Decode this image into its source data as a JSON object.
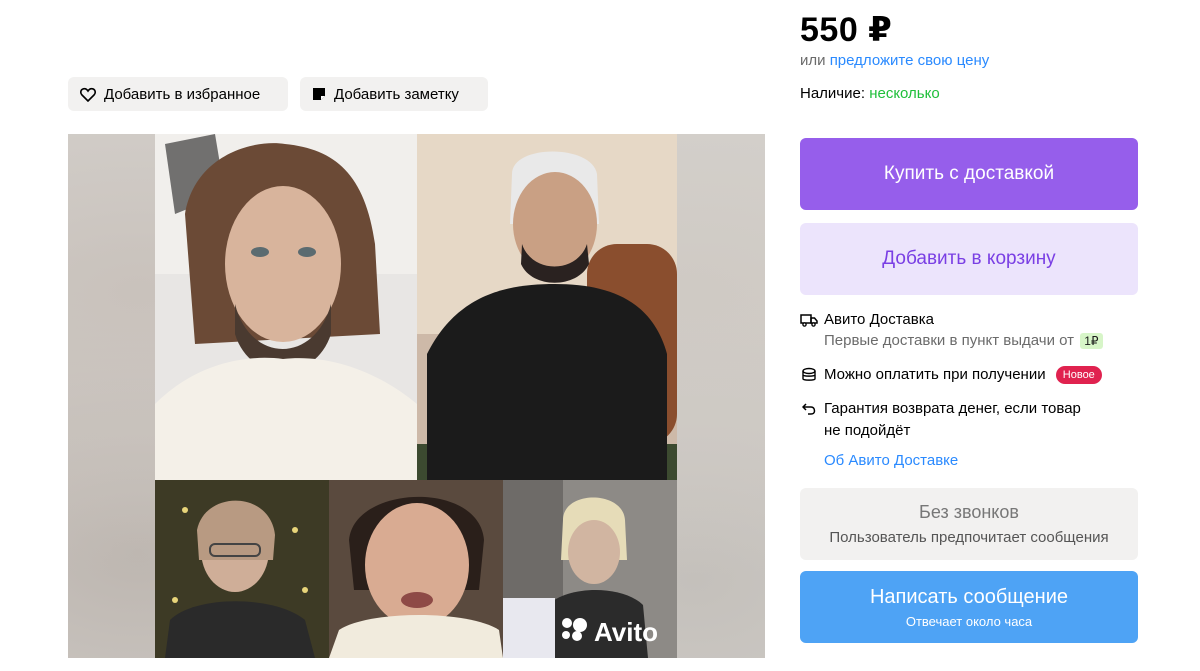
{
  "actions": {
    "favorite_label": "Добавить в избранное",
    "note_label": "Добавить заметку"
  },
  "gallery": {
    "watermark": "Avito"
  },
  "listing": {
    "price": "550 ₽",
    "price_alt_prefix": "или",
    "price_alt_link": "предложите свою цену",
    "stock_label": "Наличие:",
    "stock_value": "несколько"
  },
  "buttons": {
    "buy_label": "Купить с доставкой",
    "cart_label": "Добавить в корзину"
  },
  "delivery": {
    "title": "Авито Доставка",
    "subtitle": "Первые доставки в пункт выдачи от",
    "price_badge": "1₽",
    "pay_on_receipt": "Можно оплатить при получении",
    "new_badge": "Новое",
    "guarantee_line1": "Гарантия возврата денег, если товар",
    "guarantee_line2": "не подойдёт",
    "about_link": "Об Авито Доставке"
  },
  "contact": {
    "no_calls_title": "Без звонков",
    "no_calls_subtitle": "Пользователь предпочитает сообщения",
    "message_label": "Написать сообщение",
    "message_sub": "Отвечает около часа"
  },
  "colors": {
    "buy": "#965eeb",
    "cart_bg": "#ece4fc",
    "message": "#4ea3f5",
    "stock_green": "#1fbf3a",
    "link_blue": "#2a8aff",
    "new_badge": "#e0224f"
  },
  "icons": [
    "heart-icon",
    "note-icon",
    "truck-icon",
    "coins-icon",
    "return-arrow-icon",
    "avito-logo-icon"
  ]
}
